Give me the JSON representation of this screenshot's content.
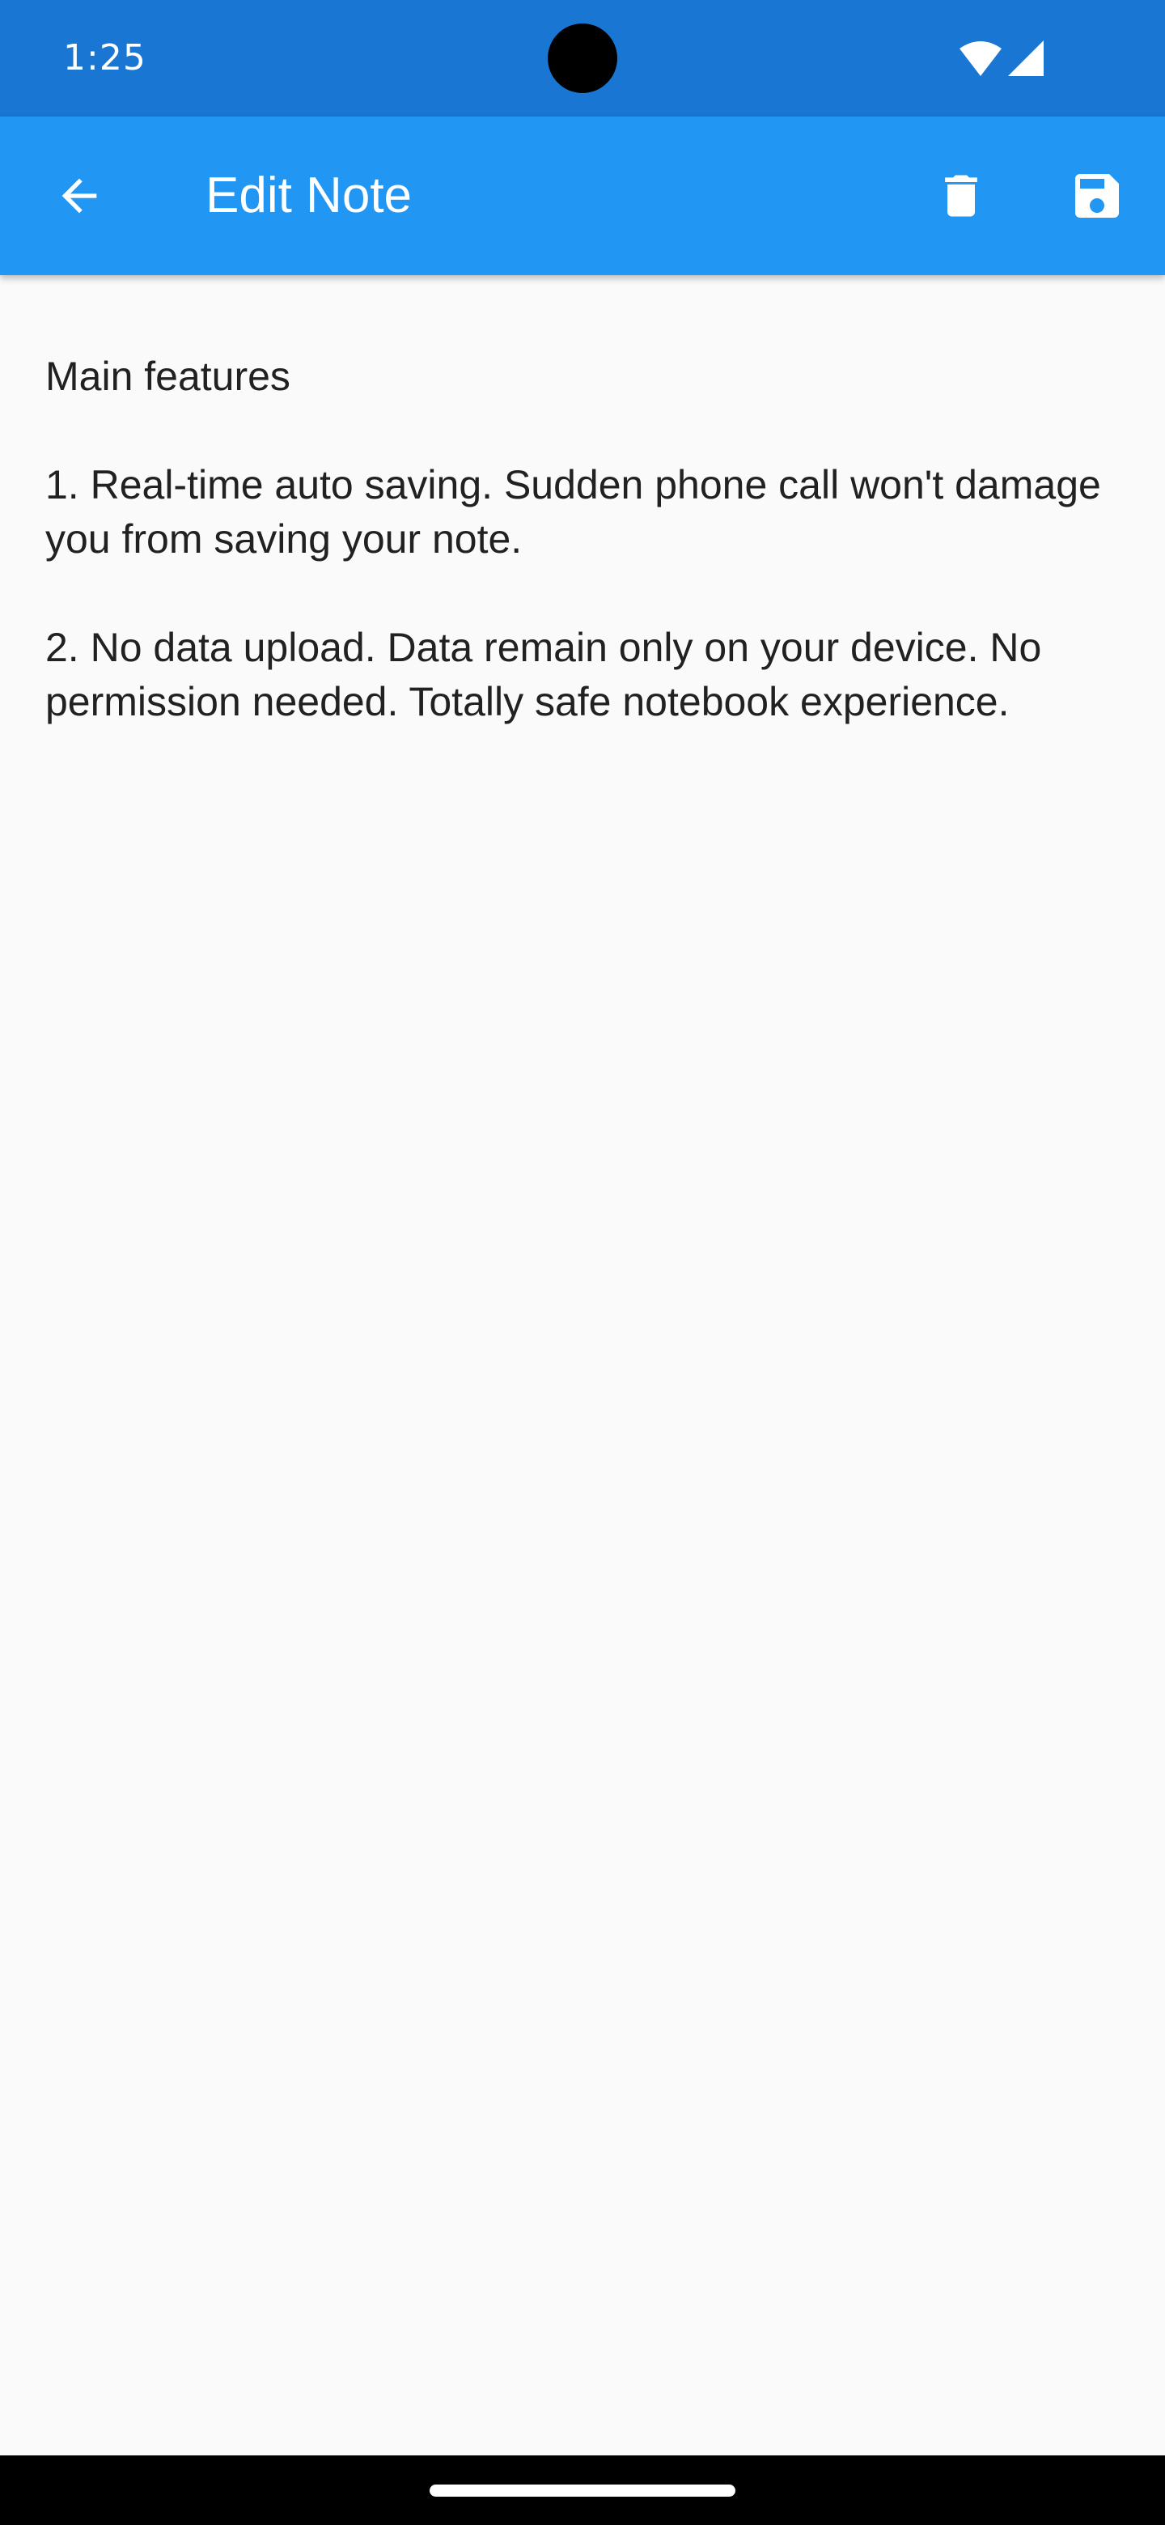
{
  "status_bar": {
    "time": "1:25",
    "icons": [
      "wifi-icon",
      "signal-icon"
    ]
  },
  "app_bar": {
    "title": "Edit Note",
    "back_icon": "arrow-back-icon",
    "delete_icon": "trash-icon",
    "save_icon": "floppy-disk-icon"
  },
  "note": {
    "content": "Main features\n\n1. Real-time auto saving. Sudden phone call won't damage you from saving your note.\n\n2. No data upload. Data remain only on your device. No permission needed. Totally safe notebook experience."
  },
  "colors": {
    "status_bar": "#1976d2",
    "app_bar": "#2196f3",
    "background": "#fafafa",
    "text": "#212121"
  }
}
